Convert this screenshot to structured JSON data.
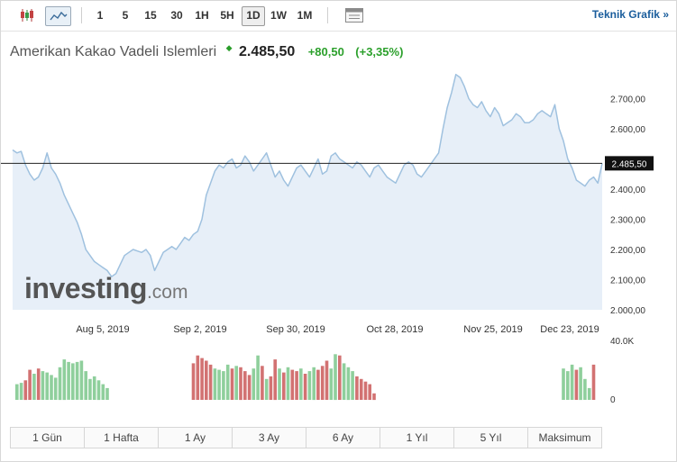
{
  "toolbar": {
    "icons": [
      "candlestick-icon",
      "area-chart-icon",
      "table-view-icon"
    ],
    "timeframes": [
      "1",
      "5",
      "15",
      "30",
      "1H",
      "5H",
      "1D",
      "1W",
      "1M"
    ],
    "active_timeframe": "1D",
    "teknik_label": "Teknik Grafik »"
  },
  "quote": {
    "name": "Amerikan Kakao Vadeli Islemleri",
    "price": "2.485,50",
    "change": "+80,50",
    "change_pct": "(+3,35%)",
    "direction": "up"
  },
  "watermark": {
    "brand": "investing",
    "tld": ".com"
  },
  "colors": {
    "line": "#9fc1df",
    "area": "#e7eff8",
    "up_volume": "#8fcf9c",
    "down_volume": "#d27272",
    "price_line": "#222222",
    "positive": "#2ca02c",
    "link": "#1a5d9c"
  },
  "chart_data": {
    "type": "area",
    "title": "Amerikan Kakao Vadeli Islemleri",
    "x_tick_labels": [
      "Aug 5, 2019",
      "Sep 2, 2019",
      "Sep 30, 2019",
      "Oct 28, 2019",
      "Nov 25, 2019",
      "Dec 23, 2019"
    ],
    "y_tick_labels": [
      "2.700,00",
      "2.600,00",
      "2.500,00",
      "2.400,00",
      "2.300,00",
      "2.200,00",
      "2.100,00",
      "2.000,00"
    ],
    "y_ticks": [
      2700,
      2600,
      2500,
      2400,
      2300,
      2200,
      2100,
      2000
    ],
    "ylim": [
      2000,
      2800
    ],
    "current_price": 2485.5,
    "current_price_label": "2.485,50",
    "grid": false,
    "series": [
      {
        "values": [
          2530,
          2520,
          2525,
          2480,
          2450,
          2430,
          2440,
          2470,
          2520,
          2470,
          2450,
          2420,
          2380,
          2350,
          2320,
          2290,
          2250,
          2200,
          2180,
          2160,
          2150,
          2140,
          2130,
          2110,
          2120,
          2150,
          2180,
          2190,
          2200,
          2195,
          2190,
          2200,
          2180,
          2130,
          2160,
          2190,
          2200,
          2210,
          2200,
          2220,
          2240,
          2230,
          2250,
          2260,
          2300,
          2380,
          2420,
          2460,
          2480,
          2470,
          2490,
          2500,
          2470,
          2480,
          2510,
          2490,
          2460,
          2480,
          2500,
          2520,
          2480,
          2440,
          2460,
          2430,
          2410,
          2440,
          2470,
          2480,
          2460,
          2440,
          2470,
          2500,
          2450,
          2460,
          2510,
          2520,
          2500,
          2490,
          2480,
          2470,
          2490,
          2480,
          2460,
          2440,
          2470,
          2480,
          2460,
          2440,
          2430,
          2420,
          2450,
          2480,
          2490,
          2480,
          2450,
          2440,
          2460,
          2480,
          2500,
          2520,
          2600,
          2670,
          2720,
          2780,
          2770,
          2740,
          2700,
          2680,
          2670,
          2690,
          2660,
          2640,
          2670,
          2650,
          2610,
          2620,
          2630,
          2650,
          2640,
          2620,
          2620,
          2630,
          2650,
          2660,
          2650,
          2640,
          2680,
          2600,
          2560,
          2500,
          2470,
          2430,
          2420,
          2410,
          2430,
          2440,
          2420,
          2485.5
        ]
      }
    ],
    "volume": {
      "axis_top_label": "40.0K",
      "axis_bottom_label": "0",
      "max": 40000,
      "bars": [
        {
          "i": 1,
          "v": 12000,
          "d": 0
        },
        {
          "i": 2,
          "v": 13000,
          "d": 0
        },
        {
          "i": 3,
          "v": 15000,
          "d": 1
        },
        {
          "i": 4,
          "v": 23000,
          "d": 1
        },
        {
          "i": 5,
          "v": 20000,
          "d": 0
        },
        {
          "i": 6,
          "v": 24000,
          "d": 1
        },
        {
          "i": 7,
          "v": 22000,
          "d": 0
        },
        {
          "i": 8,
          "v": 21000,
          "d": 0
        },
        {
          "i": 9,
          "v": 19000,
          "d": 0
        },
        {
          "i": 10,
          "v": 17000,
          "d": 0
        },
        {
          "i": 11,
          "v": 25000,
          "d": 0
        },
        {
          "i": 12,
          "v": 31000,
          "d": 0
        },
        {
          "i": 13,
          "v": 29000,
          "d": 0
        },
        {
          "i": 14,
          "v": 28000,
          "d": 0
        },
        {
          "i": 15,
          "v": 29000,
          "d": 0
        },
        {
          "i": 16,
          "v": 30000,
          "d": 0
        },
        {
          "i": 17,
          "v": 22000,
          "d": 0
        },
        {
          "i": 18,
          "v": 16000,
          "d": 0
        },
        {
          "i": 19,
          "v": 18000,
          "d": 0
        },
        {
          "i": 20,
          "v": 15000,
          "d": 0
        },
        {
          "i": 21,
          "v": 12000,
          "d": 0
        },
        {
          "i": 22,
          "v": 9000,
          "d": 0
        },
        {
          "i": 42,
          "v": 28000,
          "d": 1
        },
        {
          "i": 43,
          "v": 34000,
          "d": 1
        },
        {
          "i": 44,
          "v": 32000,
          "d": 1
        },
        {
          "i": 45,
          "v": 30000,
          "d": 1
        },
        {
          "i": 46,
          "v": 27000,
          "d": 1
        },
        {
          "i": 47,
          "v": 24000,
          "d": 0
        },
        {
          "i": 48,
          "v": 23000,
          "d": 0
        },
        {
          "i": 49,
          "v": 22000,
          "d": 0
        },
        {
          "i": 50,
          "v": 27000,
          "d": 0
        },
        {
          "i": 51,
          "v": 24000,
          "d": 1
        },
        {
          "i": 52,
          "v": 26000,
          "d": 0
        },
        {
          "i": 53,
          "v": 25000,
          "d": 1
        },
        {
          "i": 54,
          "v": 22000,
          "d": 1
        },
        {
          "i": 55,
          "v": 19000,
          "d": 1
        },
        {
          "i": 56,
          "v": 24000,
          "d": 0
        },
        {
          "i": 57,
          "v": 34000,
          "d": 0
        },
        {
          "i": 58,
          "v": 26000,
          "d": 1
        },
        {
          "i": 59,
          "v": 16000,
          "d": 0
        },
        {
          "i": 60,
          "v": 18000,
          "d": 1
        },
        {
          "i": 61,
          "v": 31000,
          "d": 1
        },
        {
          "i": 62,
          "v": 24000,
          "d": 0
        },
        {
          "i": 63,
          "v": 21000,
          "d": 1
        },
        {
          "i": 64,
          "v": 25000,
          "d": 0
        },
        {
          "i": 65,
          "v": 23000,
          "d": 1
        },
        {
          "i": 66,
          "v": 22000,
          "d": 1
        },
        {
          "i": 67,
          "v": 24000,
          "d": 0
        },
        {
          "i": 68,
          "v": 20000,
          "d": 1
        },
        {
          "i": 69,
          "v": 22000,
          "d": 0
        },
        {
          "i": 70,
          "v": 25000,
          "d": 0
        },
        {
          "i": 71,
          "v": 23000,
          "d": 1
        },
        {
          "i": 72,
          "v": 26000,
          "d": 1
        },
        {
          "i": 73,
          "v": 30000,
          "d": 1
        },
        {
          "i": 74,
          "v": 24000,
          "d": 0
        },
        {
          "i": 75,
          "v": 35000,
          "d": 0
        },
        {
          "i": 76,
          "v": 34000,
          "d": 1
        },
        {
          "i": 77,
          "v": 28000,
          "d": 0
        },
        {
          "i": 78,
          "v": 25000,
          "d": 0
        },
        {
          "i": 79,
          "v": 22000,
          "d": 0
        },
        {
          "i": 80,
          "v": 18000,
          "d": 1
        },
        {
          "i": 81,
          "v": 16000,
          "d": 1
        },
        {
          "i": 82,
          "v": 14000,
          "d": 1
        },
        {
          "i": 83,
          "v": 12000,
          "d": 1
        },
        {
          "i": 84,
          "v": 5000,
          "d": 1
        },
        {
          "i": 128,
          "v": 24000,
          "d": 0
        },
        {
          "i": 129,
          "v": 22000,
          "d": 0
        },
        {
          "i": 130,
          "v": 27000,
          "d": 0
        },
        {
          "i": 131,
          "v": 23000,
          "d": 1
        },
        {
          "i": 132,
          "v": 25000,
          "d": 0
        },
        {
          "i": 133,
          "v": 16000,
          "d": 0
        },
        {
          "i": 134,
          "v": 9000,
          "d": 0
        },
        {
          "i": 135,
          "v": 27000,
          "d": 1
        }
      ]
    }
  },
  "periods": [
    "1 Gün",
    "1 Hafta",
    "1 Ay",
    "3 Ay",
    "6 Ay",
    "1 Yıl",
    "5 Yıl",
    "Maksimum"
  ]
}
